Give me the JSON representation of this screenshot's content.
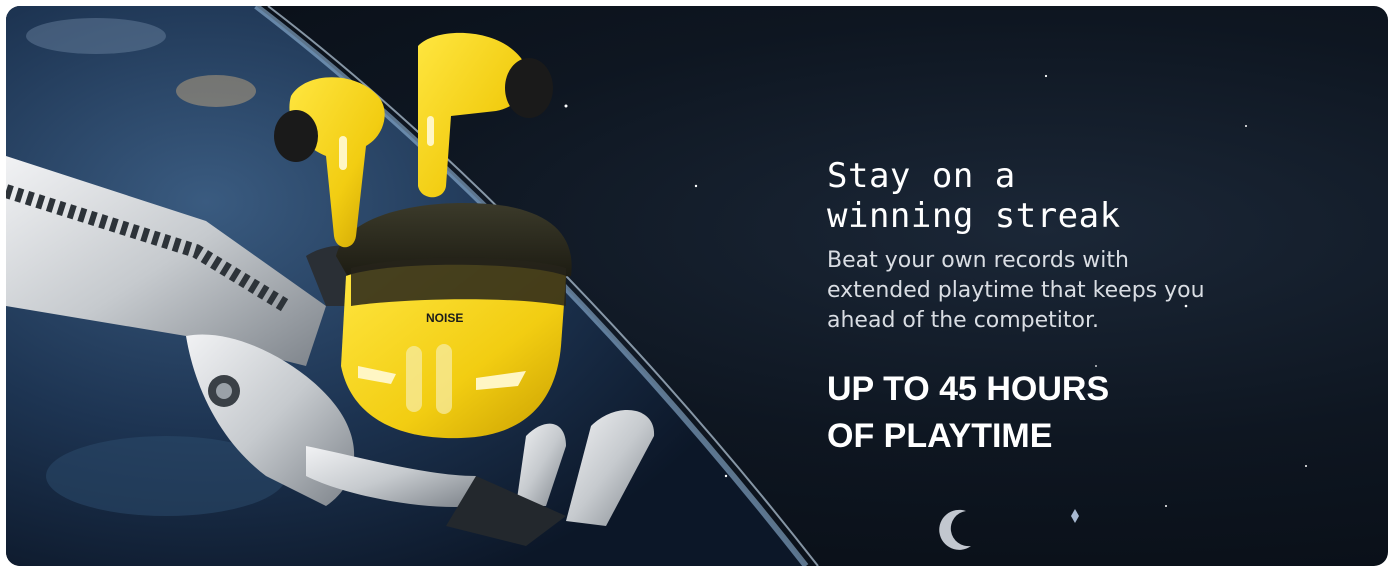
{
  "banner": {
    "headline_line1": "Stay on a",
    "headline_line2": "winning streak",
    "subtext": "Beat your own records with extended playtime that keeps you ahead of the competitor.",
    "highlight_line1": "UP TO 45 HOURS",
    "highlight_line2": "OF PLAYTIME",
    "brand_mark": "NOISE"
  },
  "colors": {
    "product_yellow": "#f2d21b",
    "space_dark": "#0b121b",
    "planet_glow": "#9fc4e8",
    "robot_white": "#d8dbdf"
  }
}
